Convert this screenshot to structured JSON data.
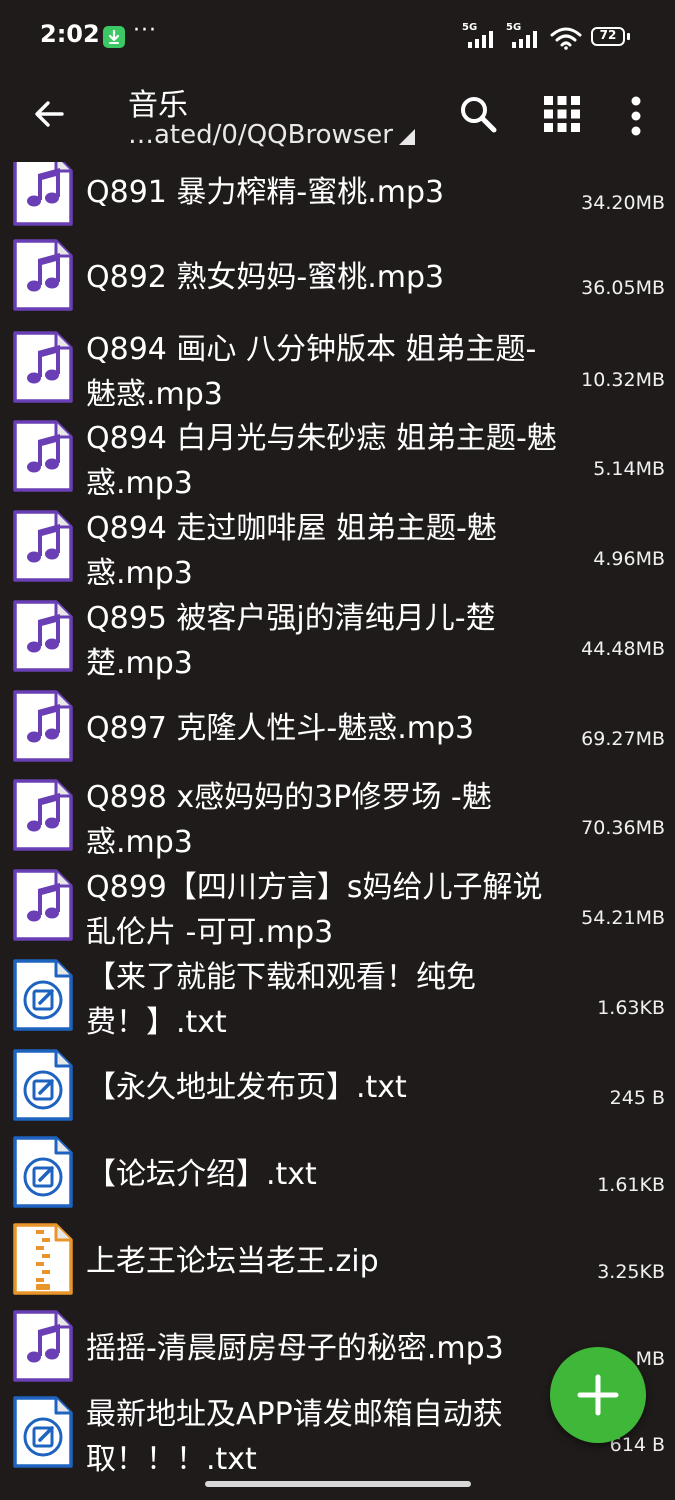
{
  "status_bar": {
    "time": "2:02",
    "more": "···",
    "network_1": "5G",
    "network_2": "5G",
    "battery": "72"
  },
  "app_bar": {
    "title": "音乐",
    "path": "…ated/0/QQBrowser"
  },
  "files": [
    {
      "name": "Q891 暴力榨精-蜜桃.mp3",
      "size": "34.20MB",
      "type": "audio"
    },
    {
      "name": "Q892 熟女妈妈-蜜桃.mp3",
      "size": "36.05MB",
      "type": "audio"
    },
    {
      "name": "Q894 画心 八分钟版本 姐弟主题-魅惑.mp3",
      "size": "10.32MB",
      "type": "audio"
    },
    {
      "name": "Q894 白月光与朱砂痣 姐弟主题-魅惑.mp3",
      "size": "5.14MB",
      "type": "audio"
    },
    {
      "name": "Q894 走过咖啡屋 姐弟主题-魅惑.mp3",
      "size": "4.96MB",
      "type": "audio"
    },
    {
      "name": "Q895 被客户强j的清纯月儿-楚楚.mp3",
      "size": "44.48MB",
      "type": "audio"
    },
    {
      "name": "Q897 克隆人性斗-魅惑.mp3",
      "size": "69.27MB",
      "type": "audio"
    },
    {
      "name": "Q898 x感妈妈的3P修罗场 -魅惑.mp3",
      "size": "70.36MB",
      "type": "audio"
    },
    {
      "name": "Q899【四川方言】s妈给儿子解说乱伦片 -可可.mp3",
      "size": "54.21MB",
      "type": "audio"
    },
    {
      "name": "【来了就能下载和观看！纯免费！】.txt",
      "size": "1.63KB",
      "type": "text"
    },
    {
      "name": "【永久地址发布页】.txt",
      "size": "245 B",
      "type": "text"
    },
    {
      "name": "【论坛介绍】.txt",
      "size": "1.61KB",
      "type": "text"
    },
    {
      "name": "上老王论坛当老王.zip",
      "size": "3.25KB",
      "type": "archive"
    },
    {
      "name": "摇摇-清晨厨房母子的秘密.mp3",
      "size": "MB",
      "type": "audio"
    },
    {
      "name": "最新地址及APP请发邮箱自动获取！！！.txt",
      "size": "614 B",
      "type": "text"
    }
  ],
  "colors": {
    "background": "#1f1b1a",
    "audio_icon": "#6a3fb5",
    "text_icon": "#1e63c0",
    "archive_icon": "#e8952a",
    "fab": "#3fb83a"
  },
  "icons": {
    "audio": "music-note-icon",
    "text": "edit-note-icon",
    "archive": "zipper-icon"
  }
}
